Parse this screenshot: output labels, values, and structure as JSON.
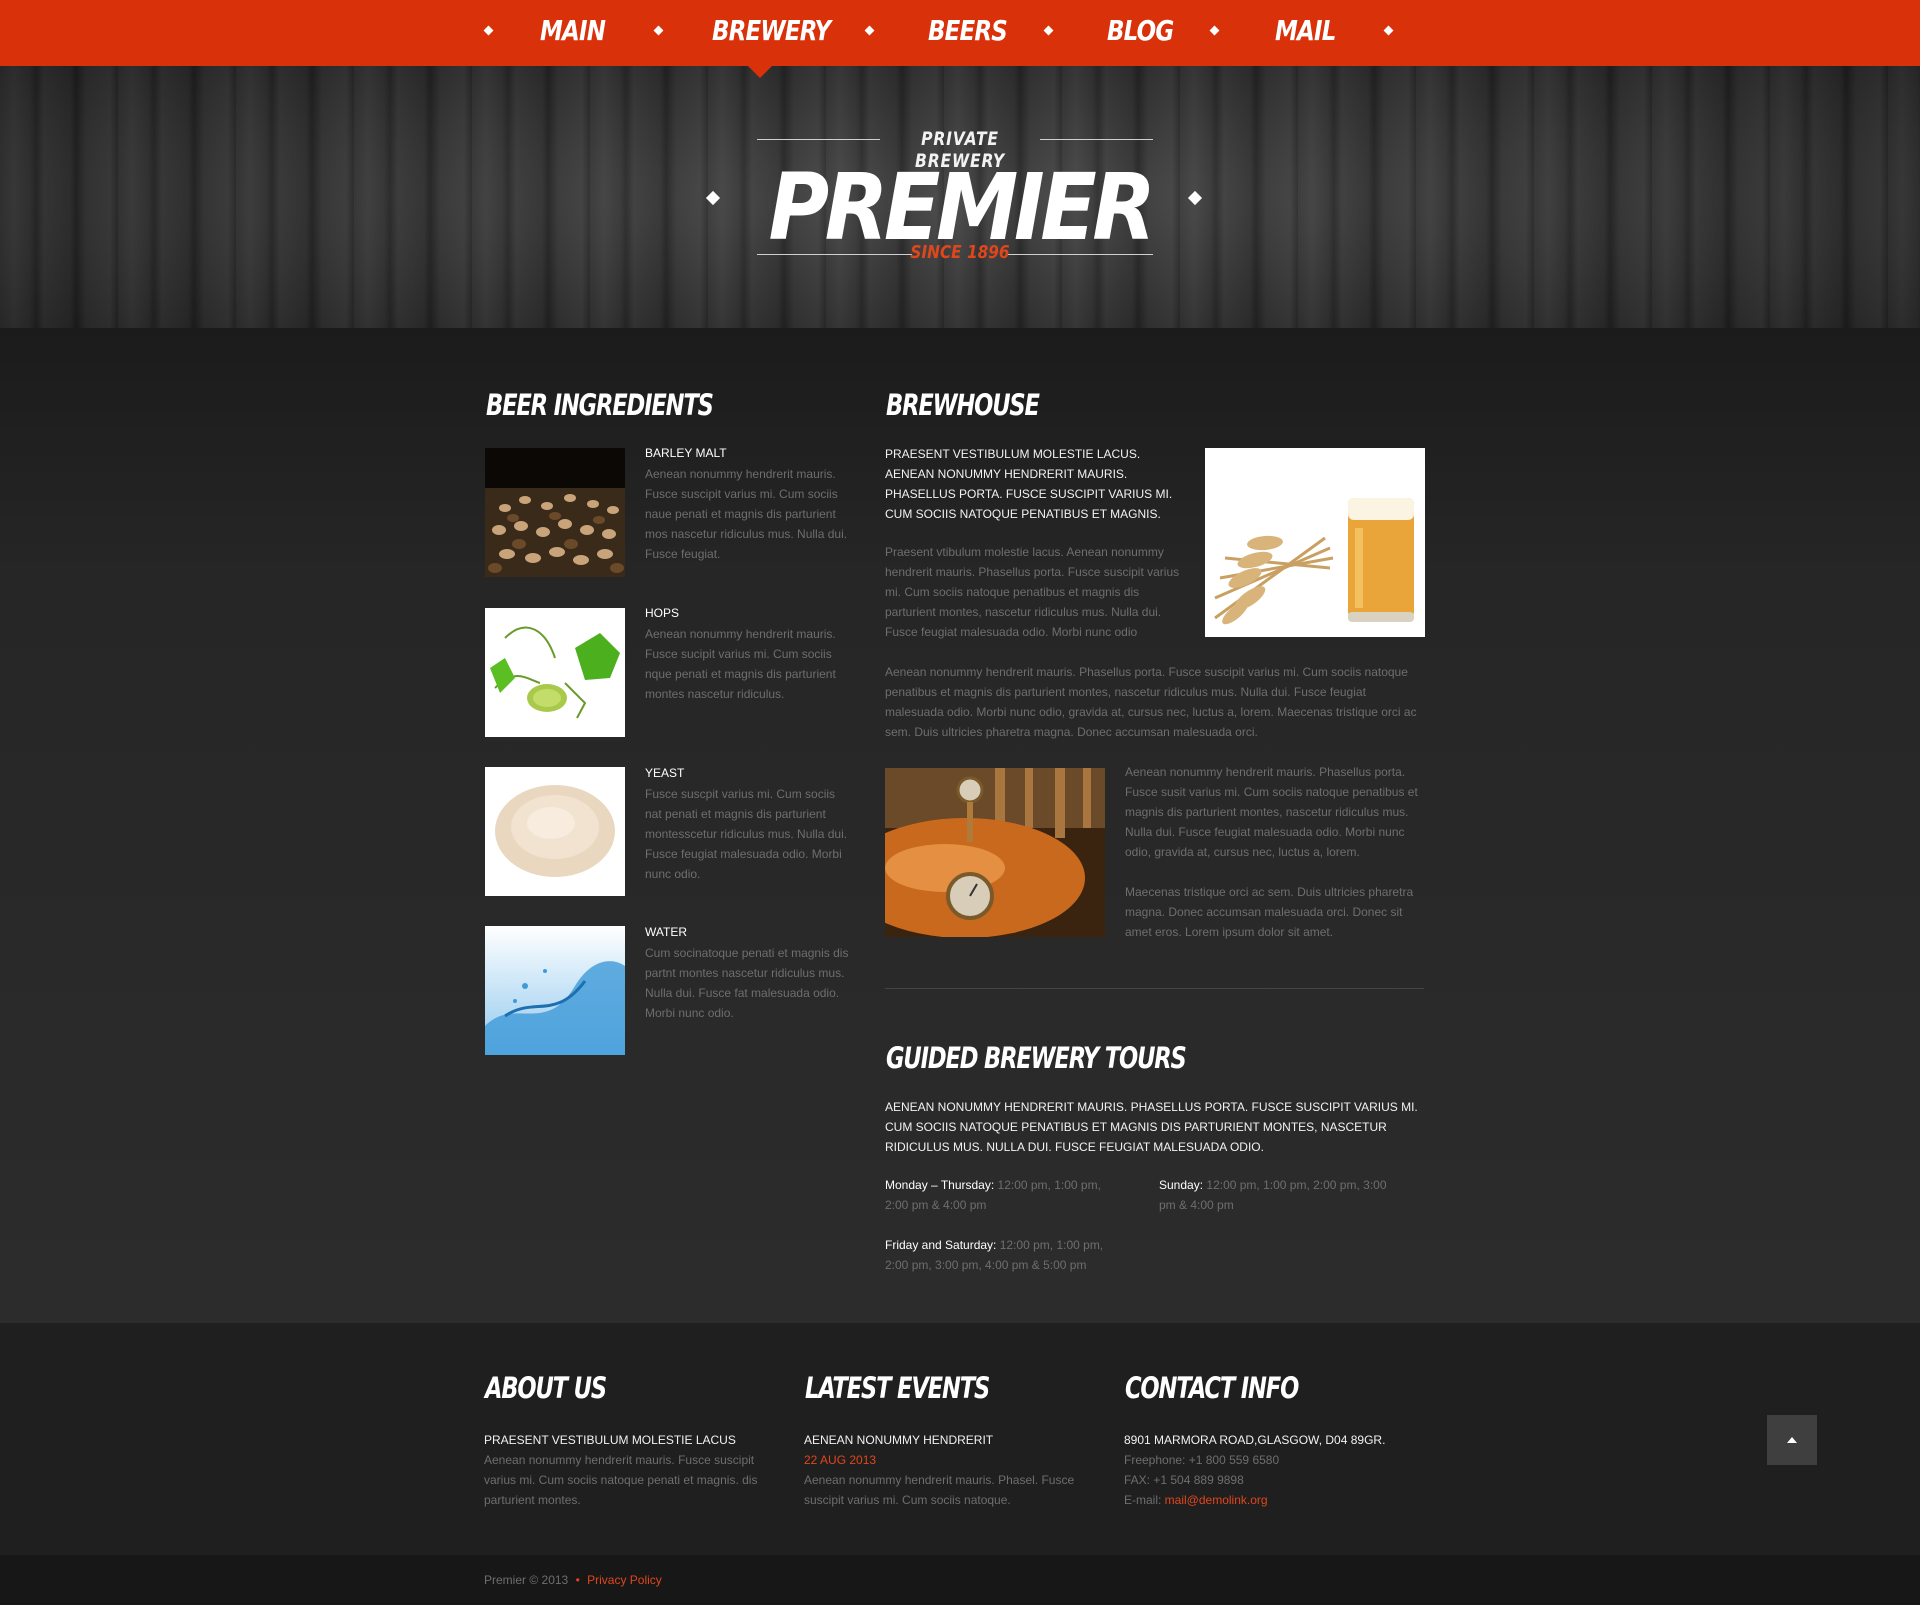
{
  "nav": {
    "items": [
      {
        "label": "MAIN"
      },
      {
        "label": "BREWERY"
      },
      {
        "label": "BEERS"
      },
      {
        "label": "BLOG"
      },
      {
        "label": "MAIL"
      }
    ],
    "active": "BREWERY",
    "accent_color": "#d9310a"
  },
  "brand": {
    "tagline": "PRIVATE  BREWERY",
    "name": "PREMIER",
    "since": "SINCE 1896"
  },
  "ingredients": {
    "heading": "BEER INGREDIENTS",
    "items": [
      {
        "title": "BARLEY MALT",
        "text": "Aenean nonummy hendrerit mauris. Fusce suscipit varius mi. Cum sociis naue penati et magnis dis parturient mos nascetur ridiculus mus. Nulla dui. Fusce feugiat."
      },
      {
        "title": "HOPS",
        "text": "Aenean nonummy hendrerit mauris. Fusce sucipit varius mi. Cum sociis nque penati et magnis dis parturient montes nascetur ridiculus."
      },
      {
        "title": "YEAST",
        "text": "Fusce suscpit varius mi. Cum sociis nat penati et magnis dis parturient montesscetur ridiculus mus. Nulla dui. Fusce feugiat malesuada odio. Morbi nunc odio."
      },
      {
        "title": "WATER",
        "text": "Cum socinatoque penati et magnis dis partnt montes nascetur ridiculus mus. Nulla dui. Fusce fat malesuada odio. Morbi nunc odio."
      }
    ]
  },
  "brewhouse": {
    "heading": "BREWHOUSE",
    "lead": "PRAESENT VESTIBULUM MOLESTIE LACUS. AENEAN NONUMMY HENDRERIT MAURIS. PHASELLUS PORTA. FUSCE SUSCIPIT VARIUS MI. CUM SOCIIS NATOQUE PENATIBUS ET MAGNIS.",
    "p1": "Praesent vtibulum molestie lacus. Aenean nonummy hendrerit mauris. Phasellus porta. Fusce suscipit varius mi. Cum sociis natoque penatibus et magnis dis parturient montes, nascetur ridiculus mus.  Nulla dui. Fusce feugiat malesuada odio. Morbi nunc odio",
    "p2": "Aenean nonummy hendrerit mauris. Phasellus porta. Fusce suscipit varius mi. Cum sociis natoque penatibus et magnis dis parturient montes, nascetur ridiculus mus. Nulla dui. Fusce feugiat malesuada odio. Morbi nunc odio, gravida at, cursus nec, luctus a, lorem. Maecenas tristique orci ac sem. Duis ultricies pharetra magna. Donec accumsan malesuada orci.",
    "p3": "Aenean nonummy hendrerit mauris. Phasellus porta. Fusce susit varius mi. Cum sociis natoque penatibus et magnis dis parturient montes, nascetur ridiculus mus. Nulla dui. Fusce feugiat malesuada odio. Morbi nunc odio, gravida at, cursus nec, luctus a, lorem.",
    "p4": "Maecenas tristique orci ac sem. Duis ultricies pharetra magna. Donec accumsan malesuada orci. Donec sit amet eros. Lorem ipsum dolor sit amet."
  },
  "tours": {
    "heading": "GUIDED BREWERY TOURS",
    "lead": "AENEAN NONUMMY HENDRERIT MAURIS. PHASELLUS PORTA. FUSCE SUSCIPIT VARIUS MI. CUM SOCIIS NATOQUE PENATIBUS ET MAGNIS DIS PARTURIENT MONTES, NASCETUR RIDICULUS MUS. NULLA DUI. FUSCE FEUGIAT MALESUADA ODIO.",
    "schedule": [
      {
        "day": "Monday – Thursday:",
        "times": "12:00 pm, 1:00 pm, 2:00 pm & 4:00 pm"
      },
      {
        "day": "Sunday:",
        "times": "12:00 pm, 1:00 pm, 2:00 pm, 3:00 pm & 4:00 pm"
      },
      {
        "day": "Friday and Saturday:",
        "times": "12:00 pm, 1:00 pm, 2:00 pm, 3:00 pm, 4:00 pm & 5:00 pm"
      }
    ]
  },
  "footer": {
    "about": {
      "heading": "ABOUT US",
      "title": "PRAESENT VESTIBULUM MOLESTIE LACUS",
      "text": "Aenean nonummy hendrerit mauris. Fusce suscipit varius mi. Cum sociis natoque penati et magnis.  dis parturient montes."
    },
    "events": {
      "heading": "LATEST EVENTS",
      "title": "AENEAN NONUMMY HENDRERIT",
      "date": "22 AUG 2013",
      "text": "Aenean nonummy hendrerit mauris. Phasel. Fusce suscipit varius mi. Cum sociis natoque."
    },
    "contact": {
      "heading": "CONTACT INFO",
      "address": "8901 MARMORA ROAD,GLASGOW, D04 89GR.",
      "freephone": "Freephone: +1 800 559 6580",
      "fax": "FAX: +1 504 889 9898",
      "email_label": "E-mail: ",
      "email": "mail@demolink.org"
    }
  },
  "bottom": {
    "copyright": "Premier © 2013",
    "separator": "•",
    "privacy": "Privacy Policy"
  },
  "icons": {
    "back_to_top": "arrow-up-icon"
  }
}
